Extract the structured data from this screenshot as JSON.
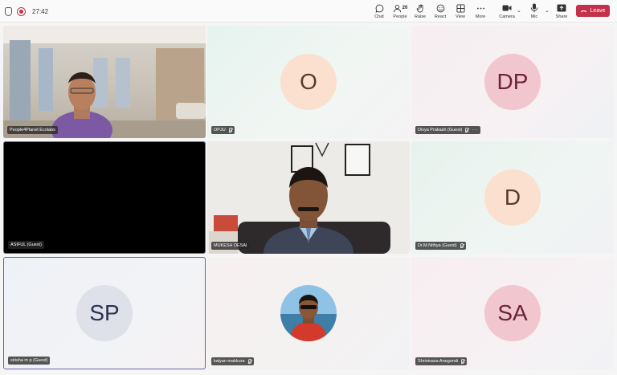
{
  "topbar": {
    "timer": "27:42",
    "people_count": "20",
    "buttons": {
      "chat": "Chat",
      "people": "People",
      "raise": "Raise",
      "react": "React",
      "view": "View",
      "more": "More",
      "camera": "Camera",
      "mic": "Mic",
      "share": "Share"
    },
    "leave": "Leave"
  },
  "tiles": [
    {
      "name": "People4Planet Ecolabs",
      "initials": ""
    },
    {
      "name": "OPJU",
      "initials": "O"
    },
    {
      "name": "Divya Prakash (Guest)",
      "initials": "DP"
    },
    {
      "name": "ASIFUL (Guest)",
      "initials": ""
    },
    {
      "name": "MUKESH DESAI",
      "initials": ""
    },
    {
      "name": "Dr.M.Nithya (Guest)",
      "initials": "D"
    },
    {
      "name": "sirisha m p (Guest)",
      "initials": "SP"
    },
    {
      "name": "kalyan makkura",
      "initials": ""
    },
    {
      "name": "Shrinivasa Anegundi",
      "initials": "SA"
    }
  ],
  "colors": {
    "accent": "#6264a7",
    "leave": "#c4314b"
  }
}
